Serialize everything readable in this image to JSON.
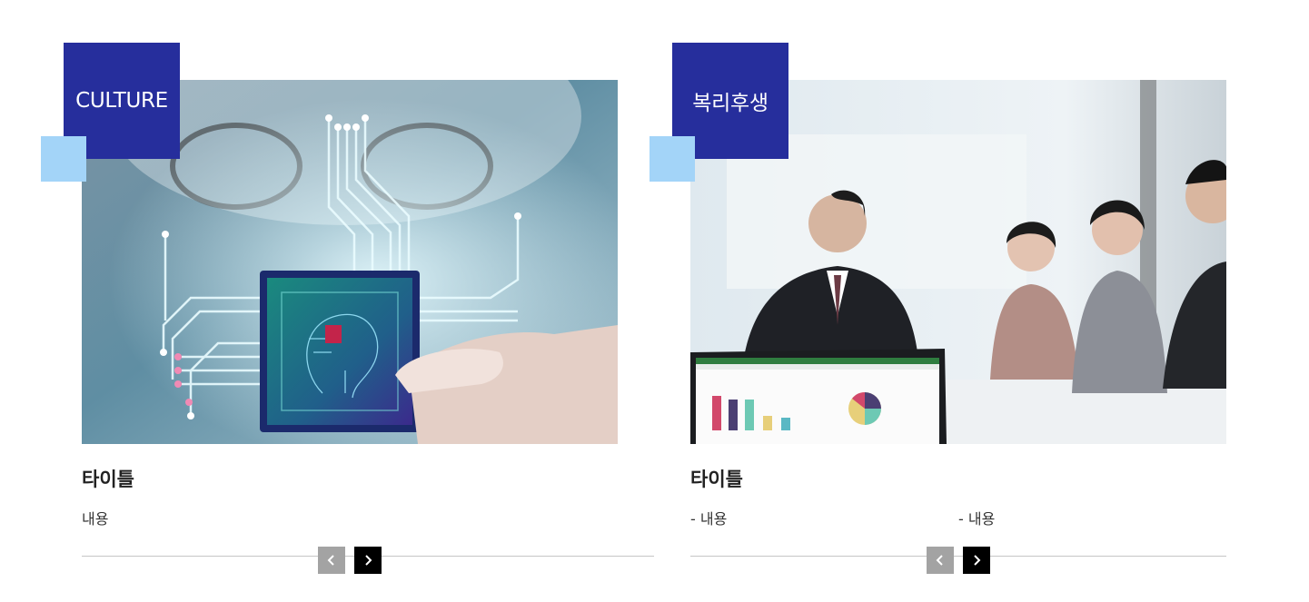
{
  "colors": {
    "label_bg": "#262e9c",
    "accent_square": "#a3d4f8",
    "prev_button": "#a3a3a3",
    "next_button": "#000000",
    "divider": "#c6c6c6"
  },
  "cards": [
    {
      "label": "CULTURE",
      "title": "타이틀",
      "contents": [
        "내용"
      ],
      "prev_icon": "chevron-left-icon",
      "next_icon": "chevron-right-icon"
    },
    {
      "label": "복리후생",
      "title": "타이틀",
      "contents": [
        "-  내용",
        "-  내용"
      ],
      "prev_icon": "chevron-left-icon",
      "next_icon": "chevron-right-icon"
    }
  ]
}
